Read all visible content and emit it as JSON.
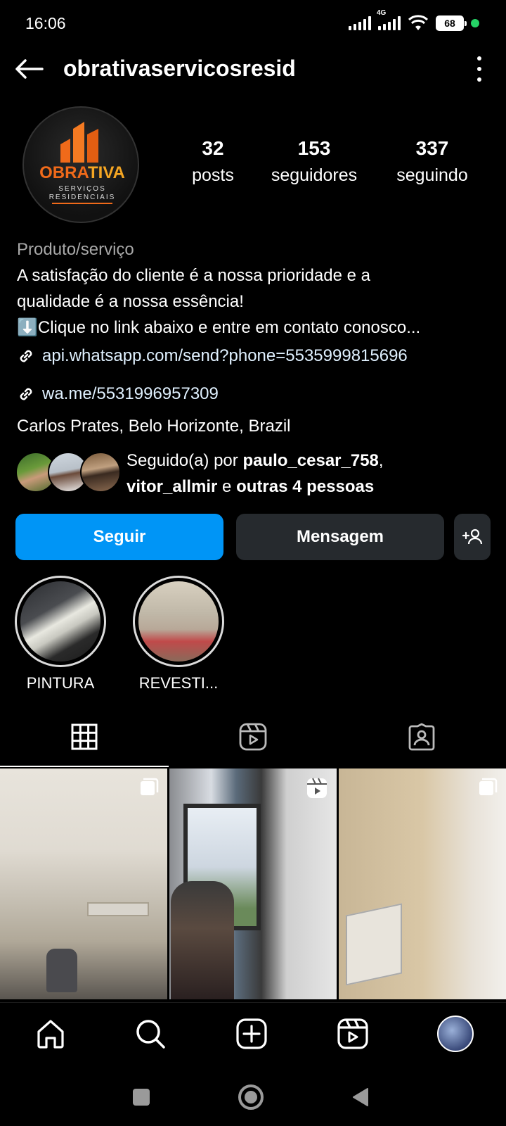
{
  "status_bar": {
    "time": "16:06",
    "network_label": "4G",
    "battery": "68"
  },
  "header": {
    "username": "obrativaservicosresid"
  },
  "profile": {
    "avatar_logo": {
      "brand": "OBRATIVA",
      "line1": "SERVIÇOS",
      "line2": "RESIDENCIAIS"
    },
    "stats": [
      {
        "count": "32",
        "label": "posts"
      },
      {
        "count": "153",
        "label": "seguidores"
      },
      {
        "count": "337",
        "label": "seguindo"
      }
    ]
  },
  "bio": {
    "category": "Produto/serviço",
    "line1": "A satisfação do cliente é a nossa prioridade e a",
    "line2": "qualidade é a nossa essência!",
    "line3_emoji": "⬇️",
    "line3": "Clique no link abaixo e entre em contato conosco...",
    "link1": "api.whatsapp.com/send?phone=5535999815696",
    "link2": "wa.me/5531996957309",
    "location": "Carlos Prates, Belo Horizonte, Brazil"
  },
  "followed_by": {
    "prefix": "Seguido(a) por ",
    "user1": "paulo_cesar_758",
    "comma": ",",
    "user2": "vitor_allmir",
    "middle": " e ",
    "others": "outras 4 pessoas"
  },
  "actions": {
    "follow": "Seguir",
    "message": "Mensagem"
  },
  "highlights": [
    {
      "label": "PINTURA"
    },
    {
      "label": "REVESTI..."
    }
  ],
  "tabs": [
    {
      "icon": "grid-icon"
    },
    {
      "icon": "reels-icon"
    },
    {
      "icon": "tagged-icon"
    }
  ],
  "posts": [
    {
      "type": "carousel"
    },
    {
      "type": "reel"
    },
    {
      "type": "carousel"
    }
  ],
  "bottom_nav": [
    "home-icon",
    "search-icon",
    "create-icon",
    "reels-icon",
    "profile-avatar"
  ],
  "colors": {
    "accent": "#0095f6",
    "background": "#000000",
    "secondary_button": "#262a2e",
    "muted_text": "#a8a8a8"
  }
}
